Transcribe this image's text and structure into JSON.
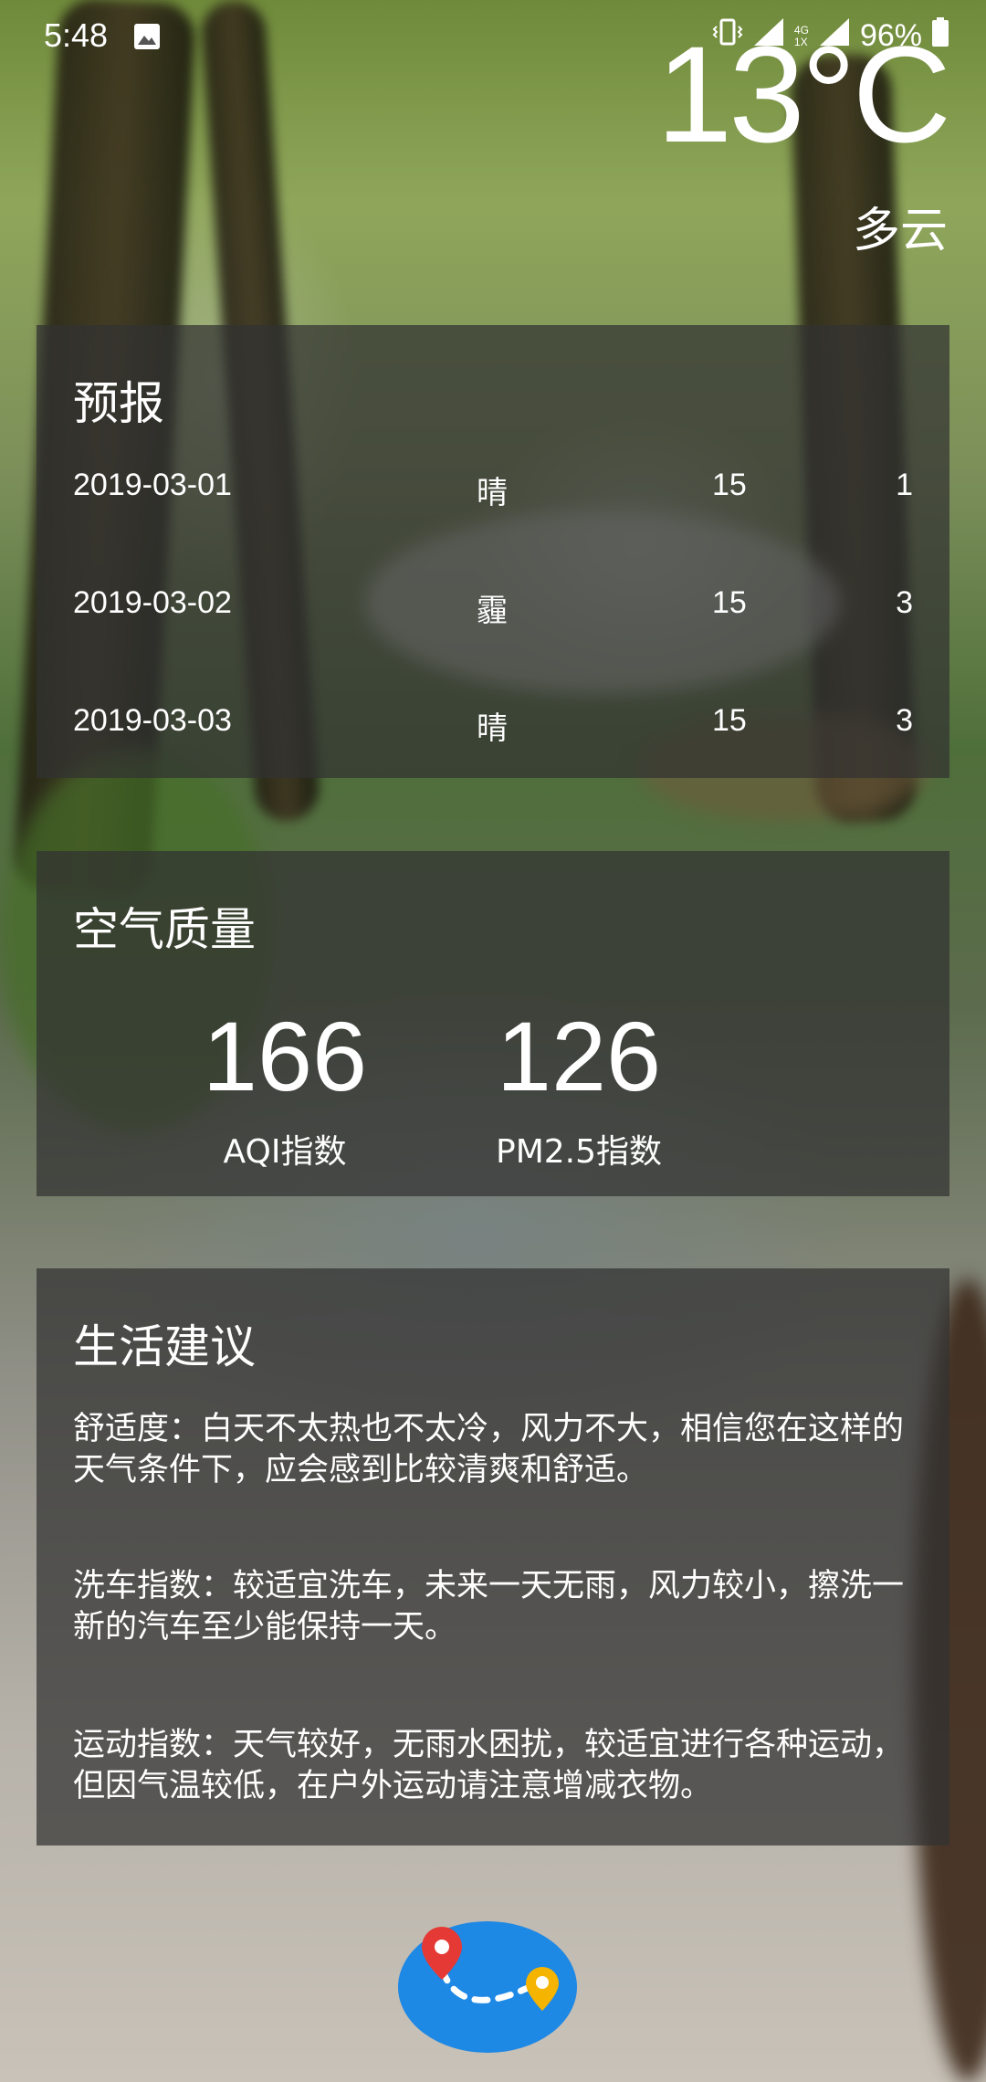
{
  "status_bar": {
    "time": "5:48",
    "network_top": "4G",
    "network_bottom": "1X",
    "battery": "96%"
  },
  "weather": {
    "temperature": "13°C",
    "condition": "多云"
  },
  "forecast": {
    "title": "预报",
    "rows": [
      {
        "date": "2019-03-01",
        "weather": "晴",
        "max": "15",
        "min": "1"
      },
      {
        "date": "2019-03-02",
        "weather": "霾",
        "max": "15",
        "min": "3"
      },
      {
        "date": "2019-03-03",
        "weather": "晴",
        "max": "15",
        "min": "3"
      }
    ]
  },
  "air_quality": {
    "title": "空气质量",
    "aqi_value": "166",
    "aqi_label": "AQI指数",
    "pm25_value": "126",
    "pm25_label": "PM2.5指数"
  },
  "suggestion": {
    "title": "生活建议",
    "comfort": "舒适度：白天不太热也不太冷，风力不大，相信您在这样的天气条件下，应会感到比较清爽和舒适。",
    "car_wash": "洗车指数：较适宜洗车，未来一天无雨，风力较小，擦洗一新的汽车至少能保持一天。",
    "sport": "运动指数：天气较好，无雨水困扰，较适宜进行各种运动，但因气温较低，在户外运动请注意增减衣物。"
  },
  "icons": {
    "status_image": "image-icon",
    "vibrate": "vibrate-icon",
    "signal": "signal-icon",
    "battery": "battery-icon",
    "fab": "map-route-icon"
  },
  "colors": {
    "fab_blue": "#1E88E5",
    "pin_red": "#E53935",
    "pin_yellow": "#F4B400",
    "card_bg": "rgba(50,50,50,0.72)"
  }
}
